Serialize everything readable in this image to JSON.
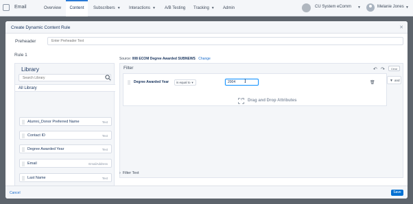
{
  "topnav": {
    "app_name": "Email",
    "tabs": [
      {
        "label": "Overview"
      },
      {
        "label": "Content"
      },
      {
        "label": "Subscribers"
      },
      {
        "label": "Interactions"
      },
      {
        "label": "A/B Testing"
      },
      {
        "label": "Tracking"
      },
      {
        "label": "Admin"
      }
    ],
    "active_tab": "Content",
    "tenant": "CU System eComm",
    "user": "Melanie Jones"
  },
  "modal": {
    "title": "Create Dynamic Content Rule",
    "preheader_label": "Preheader",
    "preheader_value": "Enter Preheader Text",
    "rule_label": "Rule 1",
    "cancel_label": "Cancel",
    "save_label": "Save"
  },
  "library": {
    "title": "Library",
    "search_placeholder": "Search Library",
    "all_label": "All Library",
    "attributes": [
      {
        "name": "Alumni_Donor Preferred Name",
        "type": "Text"
      },
      {
        "name": "Contact ID",
        "type": "Text"
      },
      {
        "name": "Degree Awarded Year",
        "type": "Text"
      },
      {
        "name": "Email",
        "type": "EmailAddress"
      },
      {
        "name": "Last Name",
        "type": "Text"
      }
    ]
  },
  "filter": {
    "source_prefix": "Source:",
    "source_name": "008 ECOM Degree Awarded SUBNEWS",
    "source_change": "Change",
    "title": "Filter",
    "clear_label": "Clear",
    "condition": {
      "attribute": "Degree Awarded Year",
      "operator": "is equal to",
      "value": "2004"
    },
    "logic_label": "and",
    "drop_hint": "Drag and Drop Attributes",
    "filter_text_label": "Filter Text"
  }
}
